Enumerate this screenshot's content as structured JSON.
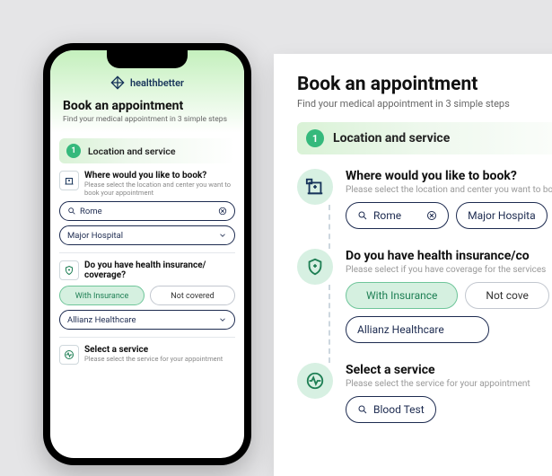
{
  "brand": {
    "name": "healthbetter"
  },
  "page": {
    "title": "Book an appointment",
    "subtitle": "Find your medical appointment in 3 simple steps"
  },
  "step": {
    "number": "1",
    "label": "Location and service"
  },
  "location": {
    "question": "Where would you like to book?",
    "help_mobile": "Please select the location and center you want to book your appointment",
    "help_desktop": "Please select the location and center you want to bo",
    "city": "Rome",
    "hospital_mobile": "Major Hospital",
    "hospital_desktop": "Major Hospita"
  },
  "insurance": {
    "question_mobile": "Do you have health insurance/ coverage?",
    "question_desktop": "Do you have health insurance/co",
    "help_desktop": "Please select if you have coverage for the services",
    "with": "With Insurance",
    "without_mobile": "Not covered",
    "without_desktop": "Not cove",
    "provider": "Allianz Healthcare"
  },
  "service": {
    "question": "Select a service",
    "help": "Please select the service for your appointment",
    "value": "Blood Test"
  }
}
